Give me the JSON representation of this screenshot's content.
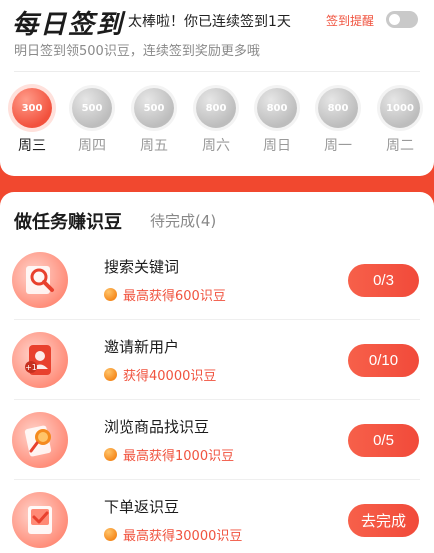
{
  "checkin": {
    "title": "每日签到",
    "streak_text": "太棒啦！你已连续签到1天",
    "reminder_label": "签到提醒",
    "reminder_on": false,
    "tomorrow_hint": "明日签到领500识豆，连续签到奖励更多哦",
    "days": [
      {
        "coins": "300",
        "label": "周三",
        "active": true
      },
      {
        "coins": "500",
        "label": "周四",
        "active": false
      },
      {
        "coins": "500",
        "label": "周五",
        "active": false
      },
      {
        "coins": "800",
        "label": "周六",
        "active": false
      },
      {
        "coins": "800",
        "label": "周日",
        "active": false
      },
      {
        "coins": "800",
        "label": "周一",
        "active": false
      },
      {
        "coins": "1000",
        "label": "周二",
        "active": false
      }
    ]
  },
  "tasks": {
    "title": "做任务赚识豆",
    "pending": "待完成(4)",
    "items": [
      {
        "name": "搜索关键词",
        "reward": "最高获得600识豆",
        "button": "0/3",
        "icon": "search-magnifier-icon"
      },
      {
        "name": "邀请新用户",
        "reward": "获得40000识豆",
        "button": "0/10",
        "icon": "invite-user-icon"
      },
      {
        "name": "浏览商品找识豆",
        "reward": "最高获得1000识豆",
        "button": "0/5",
        "icon": "browse-products-icon"
      },
      {
        "name": "下单返识豆",
        "reward": "最高获得30000识豆",
        "button": "去完成",
        "icon": "order-check-icon"
      }
    ]
  },
  "colors": {
    "accent": "#f0533f",
    "background": "#f1482f",
    "coin_inactive": "#bdbdbd"
  }
}
